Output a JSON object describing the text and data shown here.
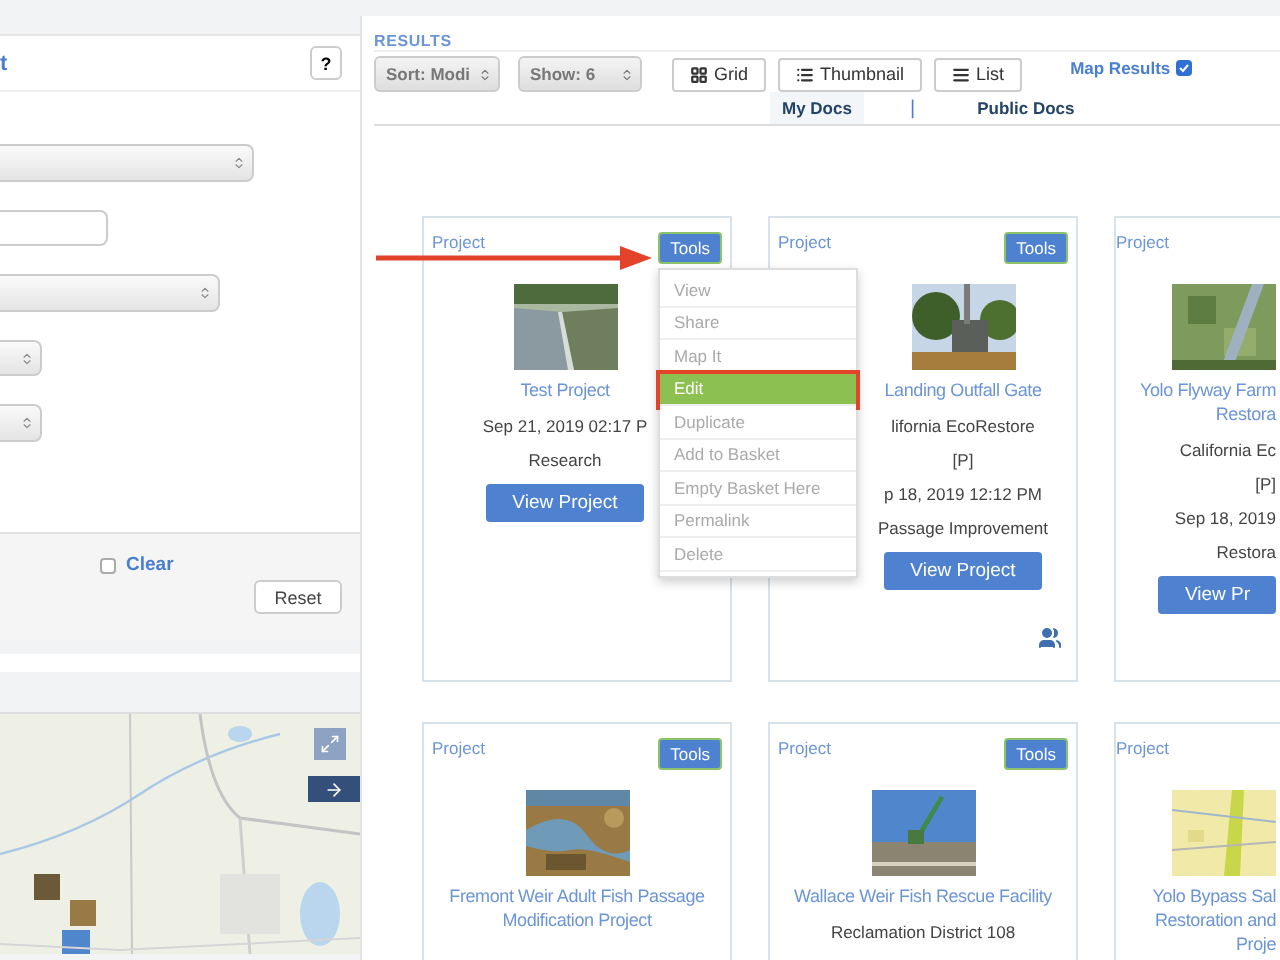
{
  "sidebar": {
    "title": "t",
    "help_button": "?",
    "fields": [
      {
        "kind": "select"
      },
      {
        "kind": "input"
      },
      {
        "kind": "select"
      },
      {
        "kind": "select"
      },
      {
        "kind": "select"
      }
    ],
    "footer": {
      "clear_label": "Clear",
      "clear_checked": false,
      "reset_button": "Reset"
    }
  },
  "results": {
    "heading": "RESULTS",
    "sort": "Sort: Modi",
    "show": "Show: 6",
    "view_buttons": [
      "Grid",
      "Thumbnail",
      "List"
    ],
    "map_results": {
      "label": "Map Results",
      "checked": true
    },
    "tabs": [
      {
        "label": "My Docs",
        "selected": true
      },
      {
        "label": "Public Docs",
        "selected": false
      }
    ],
    "tab_separator": "|",
    "cards": [
      {
        "type_label": "Project",
        "tools": "Tools",
        "title": "Test Project",
        "lines": [
          "Sep 21, 2019 02:17 P",
          "Research"
        ],
        "button": "View Project",
        "shared": false,
        "menu": [
          {
            "label": "View",
            "highlighted": false,
            "outlined": false
          },
          {
            "label": "Share",
            "highlighted": false,
            "outlined": false
          },
          {
            "label": "Map It",
            "highlighted": false,
            "outlined": false
          },
          {
            "label": "Edit",
            "highlighted": true,
            "outlined": true
          },
          {
            "label": "Duplicate",
            "highlighted": false,
            "outlined": false
          },
          {
            "label": "Add to Basket",
            "highlighted": false,
            "outlined": false
          },
          {
            "label": "Empty Basket Here",
            "highlighted": false,
            "outlined": false
          },
          {
            "label": "Permalink",
            "highlighted": false,
            "outlined": false
          },
          {
            "label": "Delete",
            "highlighted": false,
            "outlined": false
          }
        ]
      },
      {
        "type_label": "Project",
        "tools": "Tools",
        "title": "Landing Outfall Gate",
        "lines": [
          "lifornia EcoRestore",
          "[P]",
          "p 18, 2019 12:12 PM",
          "Passage Improvement"
        ],
        "button": "View Project",
        "shared": true
      },
      {
        "type_label": "Project",
        "title": "Yolo Flyway Farm\nRestora",
        "lines": [
          "California Ec",
          "[P]",
          "Sep 18, 2019",
          "Restora"
        ],
        "button": "View Pr",
        "shared": false
      },
      {
        "type_label": "Project",
        "tools": "Tools",
        "title": "Fremont Weir Adult Fish Passage\nModification Project",
        "shared": false
      },
      {
        "type_label": "Project",
        "tools": "Tools",
        "title": "Wallace Weir Fish Rescue Facility",
        "lines": [
          "Reclamation District 108"
        ],
        "shared": false
      },
      {
        "type_label": "Project",
        "title": "Yolo Bypass Sal\nRestoration and\nProje",
        "shared": false
      }
    ]
  }
}
